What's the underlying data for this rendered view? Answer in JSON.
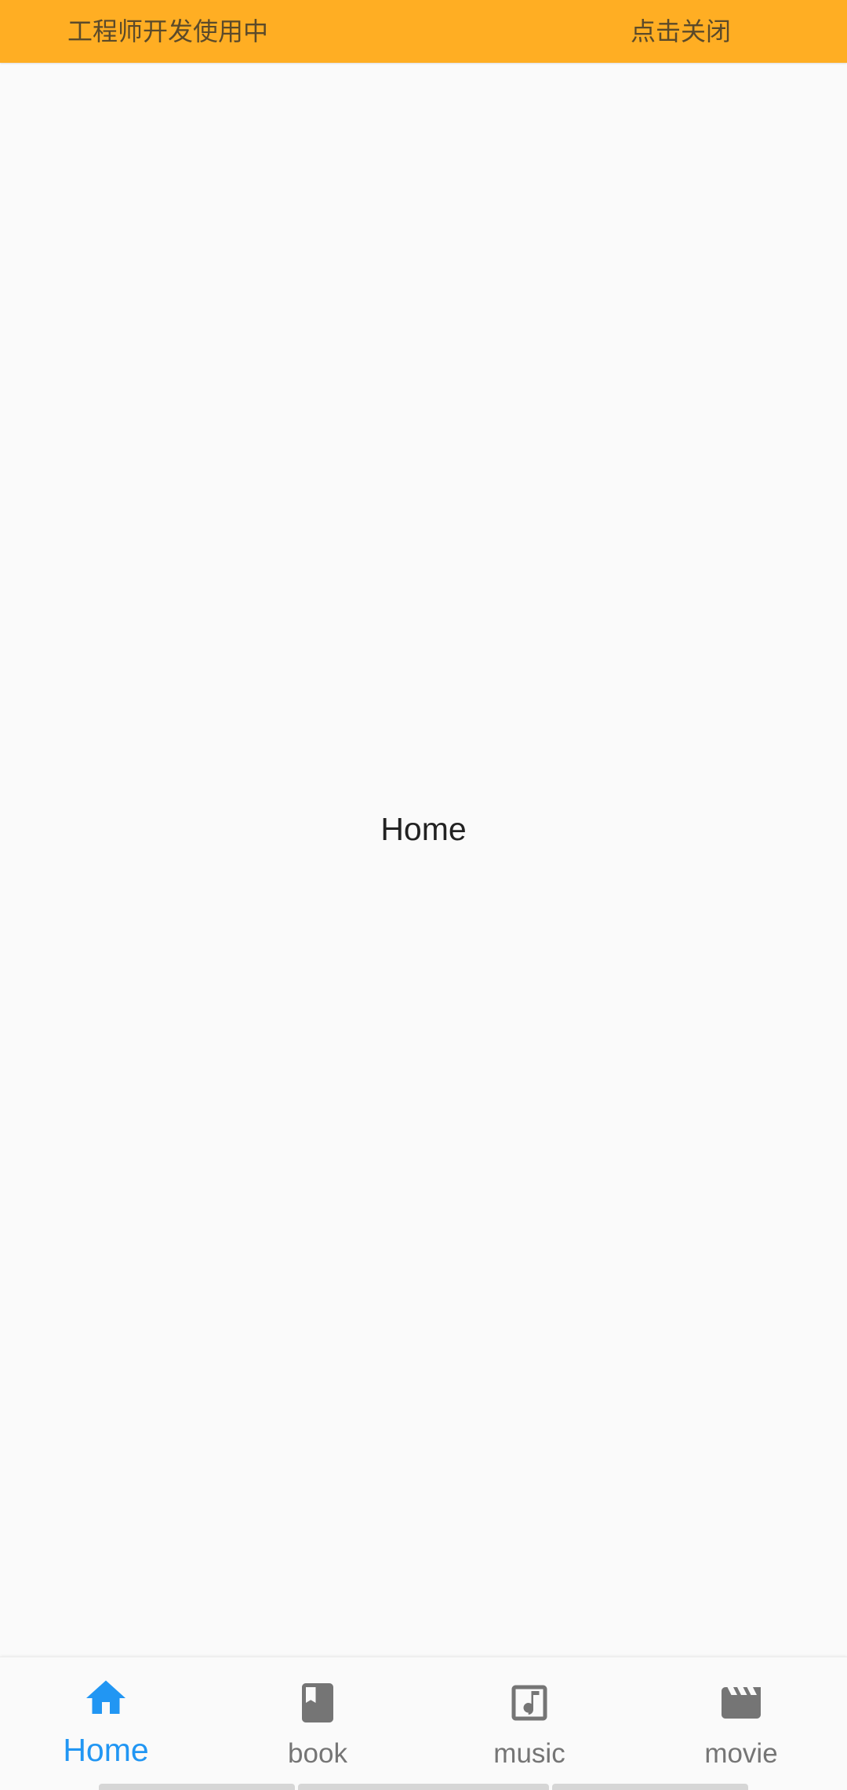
{
  "banner": {
    "text": "工程师开发使用中",
    "close_label": "点击关闭",
    "color": "#ffae23"
  },
  "main": {
    "title": "Home"
  },
  "bottom_nav": {
    "active_color": "#2196f3",
    "inactive_color": "#757575",
    "items": [
      {
        "label": "Home",
        "icon": "home-icon",
        "active": true
      },
      {
        "label": "book",
        "icon": "book-icon",
        "active": false
      },
      {
        "label": "music",
        "icon": "music-note-icon",
        "active": false
      },
      {
        "label": "movie",
        "icon": "movie-clapper-icon",
        "active": false
      }
    ]
  }
}
